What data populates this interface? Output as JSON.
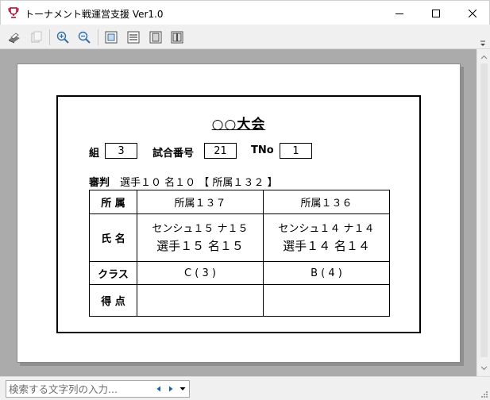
{
  "window": {
    "title": "トーナメント戦運営支援  Ver1.0",
    "icon": "trophy-icon"
  },
  "toolbar": {
    "items": [
      "print-icon",
      "copy-icon",
      "zoom-in-icon",
      "zoom-out-icon",
      "fit-page-icon",
      "fit-width-icon",
      "single-page-icon",
      "two-page-icon"
    ]
  },
  "card": {
    "event_name": "○○大会",
    "group_label": "組",
    "group_value": "3",
    "match_label": "試合番号",
    "match_value": "21",
    "tno_label": "TNo",
    "tno_value": "1",
    "judge_label": "審判",
    "judge_value": "選手１０ 名１０ 【 所属１３２ 】"
  },
  "table": {
    "rows": {
      "affiliation": "所 属",
      "name": "氏 名",
      "class": "クラス",
      "score": "得 点"
    },
    "left": {
      "affiliation": "所属１３７",
      "kana": "センシュ１５ ナ１５",
      "name": "選手１５ 名１５",
      "class": "C ( 3 )",
      "score": ""
    },
    "right": {
      "affiliation": "所属１３６",
      "kana": "センシュ１４ ナ１４",
      "name": "選手１４ 名１４",
      "class": "B ( 4 )",
      "score": ""
    }
  },
  "search": {
    "placeholder": "検索する文字列の入力...",
    "value": ""
  },
  "colors": {
    "preview_background": "#ababab",
    "paper": "#ffffff",
    "nav_arrow": "#1a5fb4"
  }
}
